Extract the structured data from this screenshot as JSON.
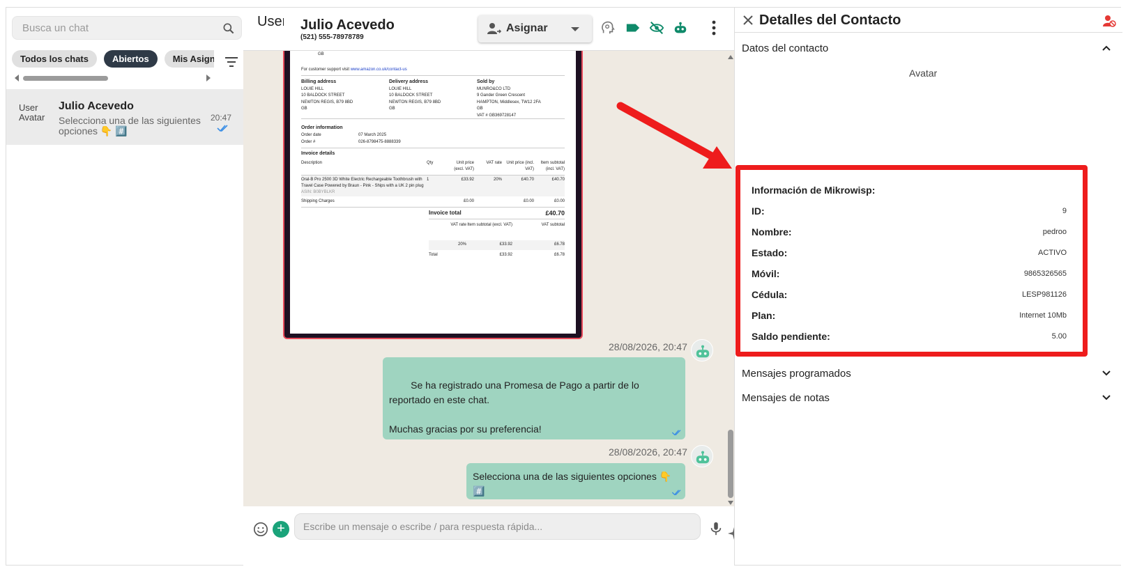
{
  "sidebar": {
    "search_placeholder": "Busca un chat",
    "chips": [
      "Todos los chats",
      "Abiertos",
      "Mis Asignados"
    ],
    "active_chip": "Abiertos",
    "chat": {
      "avatar_alt": "User Avatar",
      "name": "Julio Acevedo",
      "preview": "Selecciona una de las siguientes opciones 👇 #️⃣",
      "time": "20:47"
    }
  },
  "chat_header": {
    "avatar_alt": "User",
    "name": "Julio Acevedo",
    "phone": "(521) 555-78978789",
    "assign_label": "Asignar"
  },
  "invoice": {
    "gb_top": "GB",
    "support": "For customer support visit",
    "support_link": "www.amazon.co.uk/contact-us",
    "billing_h": "Billing address",
    "billing": [
      "LOUIE HILL",
      "10 BALDOCK STREET",
      "NEWTON REGIS, B79 8BD",
      "GB"
    ],
    "delivery_h": "Delivery address",
    "delivery": [
      "LOUIE HILL",
      "10 BALDOCK STREET",
      "NEWTON REGIS, B79 8BD",
      "GB"
    ],
    "sold_h": "Sold by",
    "sold": [
      "MUNRO&CO LTD",
      "9 Gander Green Crescent",
      "HAMPTON, Middlesex, TW12 2FA",
      "GB",
      "VAT # GB369728147"
    ],
    "order_h": "Order information",
    "order_date_k": "Order date",
    "order_date_v": "07 March 2025",
    "order_num_k": "Order #",
    "order_num_v": "026-8798475-8888339",
    "details_h": "Invoice details",
    "cols": [
      "Description",
      "Qty",
      "Unit price (excl. VAT)",
      "VAT rate",
      "Unit price (incl. VAT)",
      "Item subtotal (incl. VAT)"
    ],
    "item_desc": "Oral-B Pro 2500 3D White Electric Rechargeable Toothbrush with Travel Case Powered by Braun - Pink - Ships with a UK 2 pin plug",
    "item_asin": "ASIN: B0BYBLKR",
    "item_vals": [
      "1",
      "£33.92",
      "20%",
      "£40.70",
      "£40.70"
    ],
    "ship_desc": "Shipping Charges",
    "ship_vals": [
      "£0.00",
      "£0.00",
      "£0.00"
    ],
    "total_k": "Invoice total",
    "total_v": "£40.70",
    "vat_cols": [
      "VAT rate",
      "Item subtotal (excl. VAT)",
      "VAT subtotal"
    ],
    "vat_row": [
      "20%",
      "£33.92",
      "£6.78"
    ],
    "vat_total": [
      "Total",
      "£33.92",
      "£6.78"
    ]
  },
  "messages": [
    {
      "timestamp": "28/08/2026, 20:47",
      "text": "Se ha registrado una Promesa de Pago a partir de lo reportado en este chat.\n\nMuchas gracias por su preferencia!"
    },
    {
      "timestamp": "28/08/2026, 20:47",
      "text": "Selecciona una de las siguientes opciones 👇 #️⃣"
    }
  ],
  "composer": {
    "placeholder": "Escribe un mensaje o escribe / para respuesta rápida...",
    "ai_badge": "IA"
  },
  "details": {
    "title": "Detalles del Contacto",
    "section_contact": "Datos del contacto",
    "avatar_text": "Avatar",
    "mikrowisp_title": "Información de Mikrowisp:",
    "fields": [
      {
        "label": "ID:",
        "value": "9"
      },
      {
        "label": "Nombre:",
        "value": "pedroo"
      },
      {
        "label": "Estado:",
        "value": "ACTIVO"
      },
      {
        "label": "Móvil:",
        "value": "9865326565"
      },
      {
        "label": "Cédula:",
        "value": "LESP981126"
      },
      {
        "label": "Plan:",
        "value": "Internet 10Mb"
      },
      {
        "label": "Saldo pendiente:",
        "value": "5.00"
      }
    ],
    "section_scheduled": "Mensajes programados",
    "section_notes": "Mensajes de notas"
  },
  "colors": {
    "accent": "#1aa37a",
    "bubble": "#9fd4c0",
    "highlight": "#ee1c1c",
    "tag": "#0f8a6a"
  }
}
